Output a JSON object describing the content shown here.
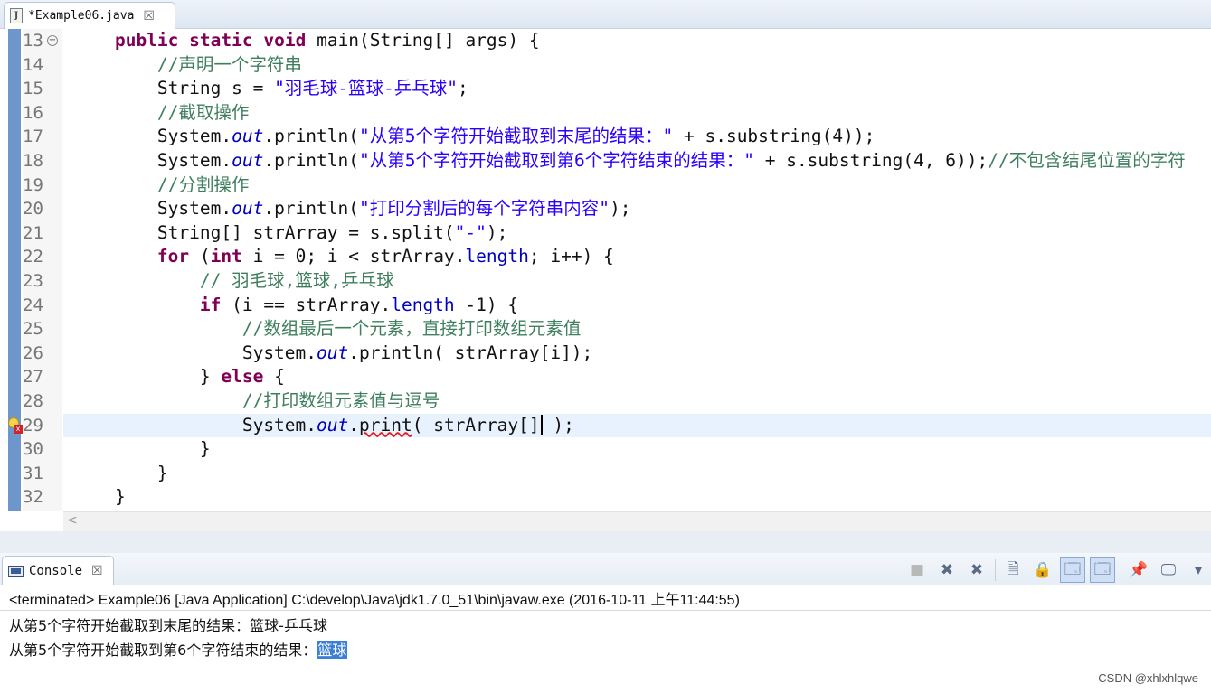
{
  "editor": {
    "tab_title": "*Example06.java",
    "tab_close": "☒",
    "file_icon": "J",
    "lines": [
      {
        "n": "13",
        "tokens": [
          {
            "t": "    "
          },
          {
            "t": "public",
            "c": "kw"
          },
          {
            "t": " "
          },
          {
            "t": "static",
            "c": "kw"
          },
          {
            "t": " "
          },
          {
            "t": "void",
            "c": "kw"
          },
          {
            "t": " main(String[] args) {"
          }
        ]
      },
      {
        "n": "14",
        "tokens": [
          {
            "t": "        "
          },
          {
            "t": "//声明一个字符串",
            "c": "cmt"
          }
        ]
      },
      {
        "n": "15",
        "tokens": [
          {
            "t": "        String s = "
          },
          {
            "t": "\"羽毛球-篮球-乒乓球\"",
            "c": "str"
          },
          {
            "t": ";"
          }
        ]
      },
      {
        "n": "16",
        "tokens": [
          {
            "t": "        "
          },
          {
            "t": "//截取操作",
            "c": "cmt"
          }
        ]
      },
      {
        "n": "17",
        "tokens": [
          {
            "t": "        System."
          },
          {
            "t": "out",
            "c": "fld"
          },
          {
            "t": ".println("
          },
          {
            "t": "\"从第5个字符开始截取到末尾的结果：\"",
            "c": "str"
          },
          {
            "t": " + s.substring(4));"
          }
        ]
      },
      {
        "n": "18",
        "tokens": [
          {
            "t": "        System."
          },
          {
            "t": "out",
            "c": "fld"
          },
          {
            "t": ".println("
          },
          {
            "t": "\"从第5个字符开始截取到第6个字符结束的结果：\"",
            "c": "str"
          },
          {
            "t": " + s.substring(4, 6));"
          },
          {
            "t": "//不包含结尾位置的字符",
            "c": "cmt"
          }
        ]
      },
      {
        "n": "19",
        "tokens": [
          {
            "t": "        "
          },
          {
            "t": "//分割操作",
            "c": "cmt"
          }
        ]
      },
      {
        "n": "20",
        "tokens": [
          {
            "t": "        System."
          },
          {
            "t": "out",
            "c": "fld"
          },
          {
            "t": ".println("
          },
          {
            "t": "\"打印分割后的每个字符串内容\"",
            "c": "str"
          },
          {
            "t": ");"
          }
        ]
      },
      {
        "n": "21",
        "tokens": [
          {
            "t": "        String[] strArray = s.split("
          },
          {
            "t": "\"-\"",
            "c": "str"
          },
          {
            "t": ");"
          }
        ]
      },
      {
        "n": "22",
        "tokens": [
          {
            "t": "        "
          },
          {
            "t": "for",
            "c": "kw"
          },
          {
            "t": " ("
          },
          {
            "t": "int",
            "c": "kw"
          },
          {
            "t": " i = 0; i < strArray."
          },
          {
            "t": "length",
            "c": "fld2"
          },
          {
            "t": "; i++) {"
          }
        ]
      },
      {
        "n": "23",
        "tokens": [
          {
            "t": "            "
          },
          {
            "t": "// 羽毛球,篮球,乒乓球",
            "c": "cmt"
          }
        ]
      },
      {
        "n": "24",
        "tokens": [
          {
            "t": "            "
          },
          {
            "t": "if",
            "c": "kw"
          },
          {
            "t": " (i == strArray."
          },
          {
            "t": "length",
            "c": "fld2"
          },
          {
            "t": " -1) {"
          }
        ]
      },
      {
        "n": "25",
        "tokens": [
          {
            "t": "                "
          },
          {
            "t": "//数组最后一个元素，直接打印数组元素值",
            "c": "cmt"
          }
        ]
      },
      {
        "n": "26",
        "tokens": [
          {
            "t": "                System."
          },
          {
            "t": "out",
            "c": "fld"
          },
          {
            "t": ".println( strArray[i]);"
          }
        ]
      },
      {
        "n": "27",
        "tokens": [
          {
            "t": "            } "
          },
          {
            "t": "else",
            "c": "kw"
          },
          {
            "t": " {"
          }
        ]
      },
      {
        "n": "28",
        "tokens": [
          {
            "t": "                "
          },
          {
            "t": "//打印数组元素值与逗号",
            "c": "cmt"
          }
        ]
      },
      {
        "n": "29",
        "tokens": [
          {
            "t": "                System."
          },
          {
            "t": "out",
            "c": "fld"
          },
          {
            "t": "."
          },
          {
            "t": "print",
            "c": "err"
          },
          {
            "t": "( strArray[]"
          },
          {
            "t": "",
            "c": "caret"
          },
          {
            "t": " );"
          }
        ]
      },
      {
        "n": "30",
        "tokens": [
          {
            "t": "            }"
          }
        ]
      },
      {
        "n": "31",
        "tokens": [
          {
            "t": "        }"
          }
        ]
      },
      {
        "n": "32",
        "tokens": [
          {
            "t": "    }"
          }
        ]
      }
    ],
    "fold_icon": "−",
    "scroll_left": "<"
  },
  "console": {
    "tab_title": "Console",
    "tab_close": "☒",
    "status": "<terminated> Example06 [Java Application] C:\\develop\\Java\\jdk1.7.0_51\\bin\\javaw.exe (2016-10-11 上午11:44:55)",
    "output_line1": "从第5个字符开始截取到末尾的结果：篮球-乒乓球",
    "output_line2_prefix": "从第5个字符开始截取到第6个字符结束的结果：",
    "output_line2_selected": "篮球",
    "toolbar": [
      {
        "name": "terminate-icon",
        "glyph": "■",
        "dim": true
      },
      {
        "name": "remove-launch-icon",
        "glyph": "✖"
      },
      {
        "name": "remove-all-icon",
        "glyph": "✖"
      },
      {
        "name": "sep"
      },
      {
        "name": "clear-console-icon",
        "glyph": "🗎"
      },
      {
        "name": "scroll-lock-icon",
        "glyph": "🔒"
      },
      {
        "name": "show-on-stdout-icon",
        "glyph": "🗔",
        "active": true
      },
      {
        "name": "show-on-stderr-icon",
        "glyph": "🗔",
        "active": true
      },
      {
        "name": "sep"
      },
      {
        "name": "pin-console-icon",
        "glyph": "📌"
      },
      {
        "name": "display-console-icon",
        "glyph": "🖵"
      },
      {
        "name": "view-menu-icon",
        "glyph": "▾"
      }
    ]
  },
  "watermark": "CSDN @xhlxhlqwe"
}
